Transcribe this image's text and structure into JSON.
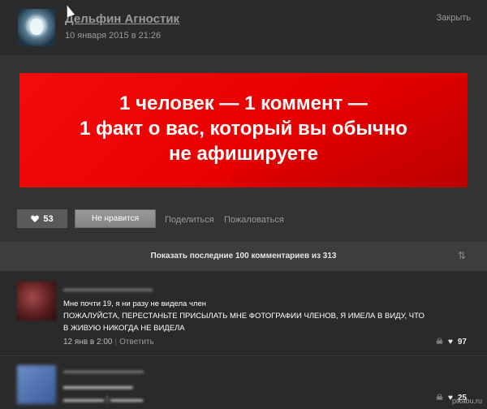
{
  "post": {
    "author": "Дельфин Агностик",
    "date": "10 января 2015 в 21:26",
    "close_label": "Закрыть",
    "banner_lines": [
      "1 человек — 1 коммент —",
      "1 факт о вас, который вы обычно",
      "не афишируете"
    ]
  },
  "actions": {
    "like_icon": "heart-icon",
    "like_count": "53",
    "dislike_label": "Не нравится",
    "share_label": "Поделиться",
    "report_label": "Пожаловаться"
  },
  "comments_bar": {
    "label": "Показать последние 100 комментариев из 313",
    "sort_icon": "⇅"
  },
  "comments": [
    {
      "text_lines": [
        "Мне почти 19, я ни разу не видела член",
        "ПОЖАЛУЙСТА, ПЕРЕСТАНЬТЕ ПРИСЫЛАТЬ МНЕ ФОТОГРАФИИ ЧЛЕНОВ, Я ИМЕЛА В ВИДУ, ЧТО",
        "В ЖИВУЮ НИКОГДА НЕ ВИДЕЛА"
      ],
      "time": "12 янв в 2:00",
      "reply_label": "Ответить",
      "rating": "97"
    },
    {
      "rating": "25"
    }
  ],
  "watermark": "pikabu.ru",
  "colors": {
    "background": "#2a2a2a",
    "banner": "#e60000",
    "text": "#dddddd",
    "muted": "#9a9a9a"
  }
}
